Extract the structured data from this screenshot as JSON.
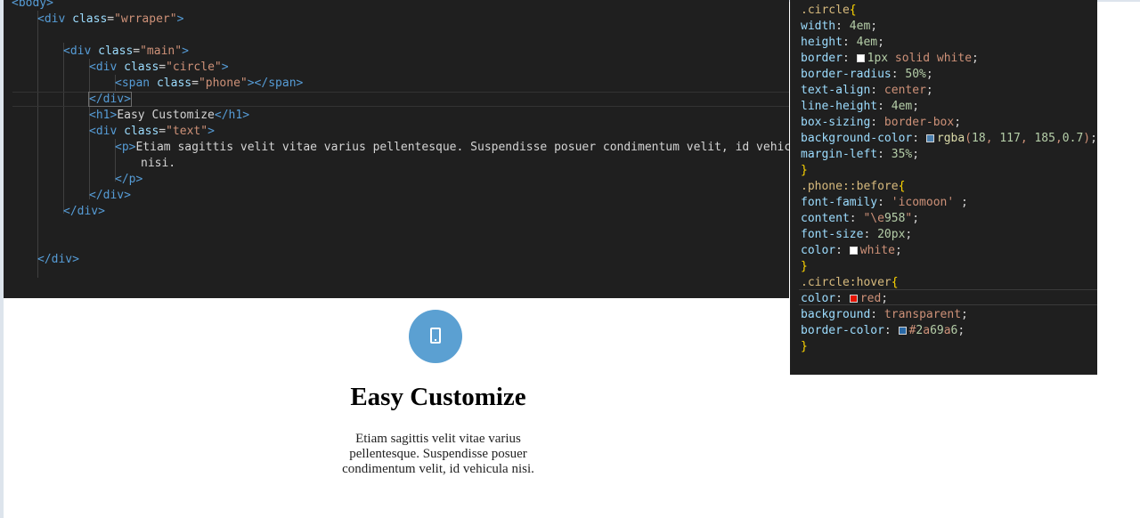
{
  "html_editor": {
    "lines": [
      [
        "<body>"
      ],
      [
        "<div ",
        "class",
        "=",
        "\"wrraper\"",
        ">"
      ],
      [
        ""
      ],
      [
        "<div ",
        "class",
        "=",
        "\"main\"",
        ">"
      ],
      [
        "<div ",
        "class",
        "=",
        "\"circle\"",
        ">"
      ],
      [
        "<span ",
        "class",
        "=",
        "\"phone\"",
        "></span>"
      ],
      [
        "</div>"
      ],
      [
        "<h1>",
        "Easy Customize",
        "</h1>"
      ],
      [
        "<div ",
        "class",
        "=",
        "\"text\"",
        ">"
      ],
      [
        "<p>",
        "Etiam sagittis velit vitae varius pellentesque. Suspendisse posuer condimentum velit, id vehicula"
      ],
      [
        "nisi."
      ],
      [
        "</p>"
      ],
      [
        "</div>"
      ],
      [
        "</div>"
      ],
      [
        ""
      ],
      [
        ""
      ],
      [
        "</div>"
      ]
    ]
  },
  "css_editor": {
    "lines": [
      ".circle{",
      "width: 4em;",
      "height: 4em;",
      "border: 1px solid white;",
      "border-radius: 50%;",
      "text-align: center;",
      "line-height: 4em;",
      "box-sizing: border-box;",
      "background-color: rgba(18, 117, 185,0.7);",
      "margin-left: 35%;",
      "}",
      ".phone::before{",
      "font-family: 'icomoon' ;",
      "content: \"\\e958\";",
      "font-size: 20px;",
      "color: white;",
      "}",
      ".circle:hover{",
      "color: red;",
      "background: transparent;",
      "border-color: #2a69a6;",
      "}"
    ],
    "swatch_colors": {
      "white": "#ffffff",
      "rgba": "#4a7fae",
      "red": "#e51400",
      "blue": "#2a69a6"
    }
  },
  "preview": {
    "icon": "phone-icon",
    "circle_color": "#5ba0d2",
    "title": "Easy Customize",
    "text": "Etiam sagittis velit vitae varius pellentesque. Suspendisse posuer condimentum velit, id vehicula nisi."
  }
}
